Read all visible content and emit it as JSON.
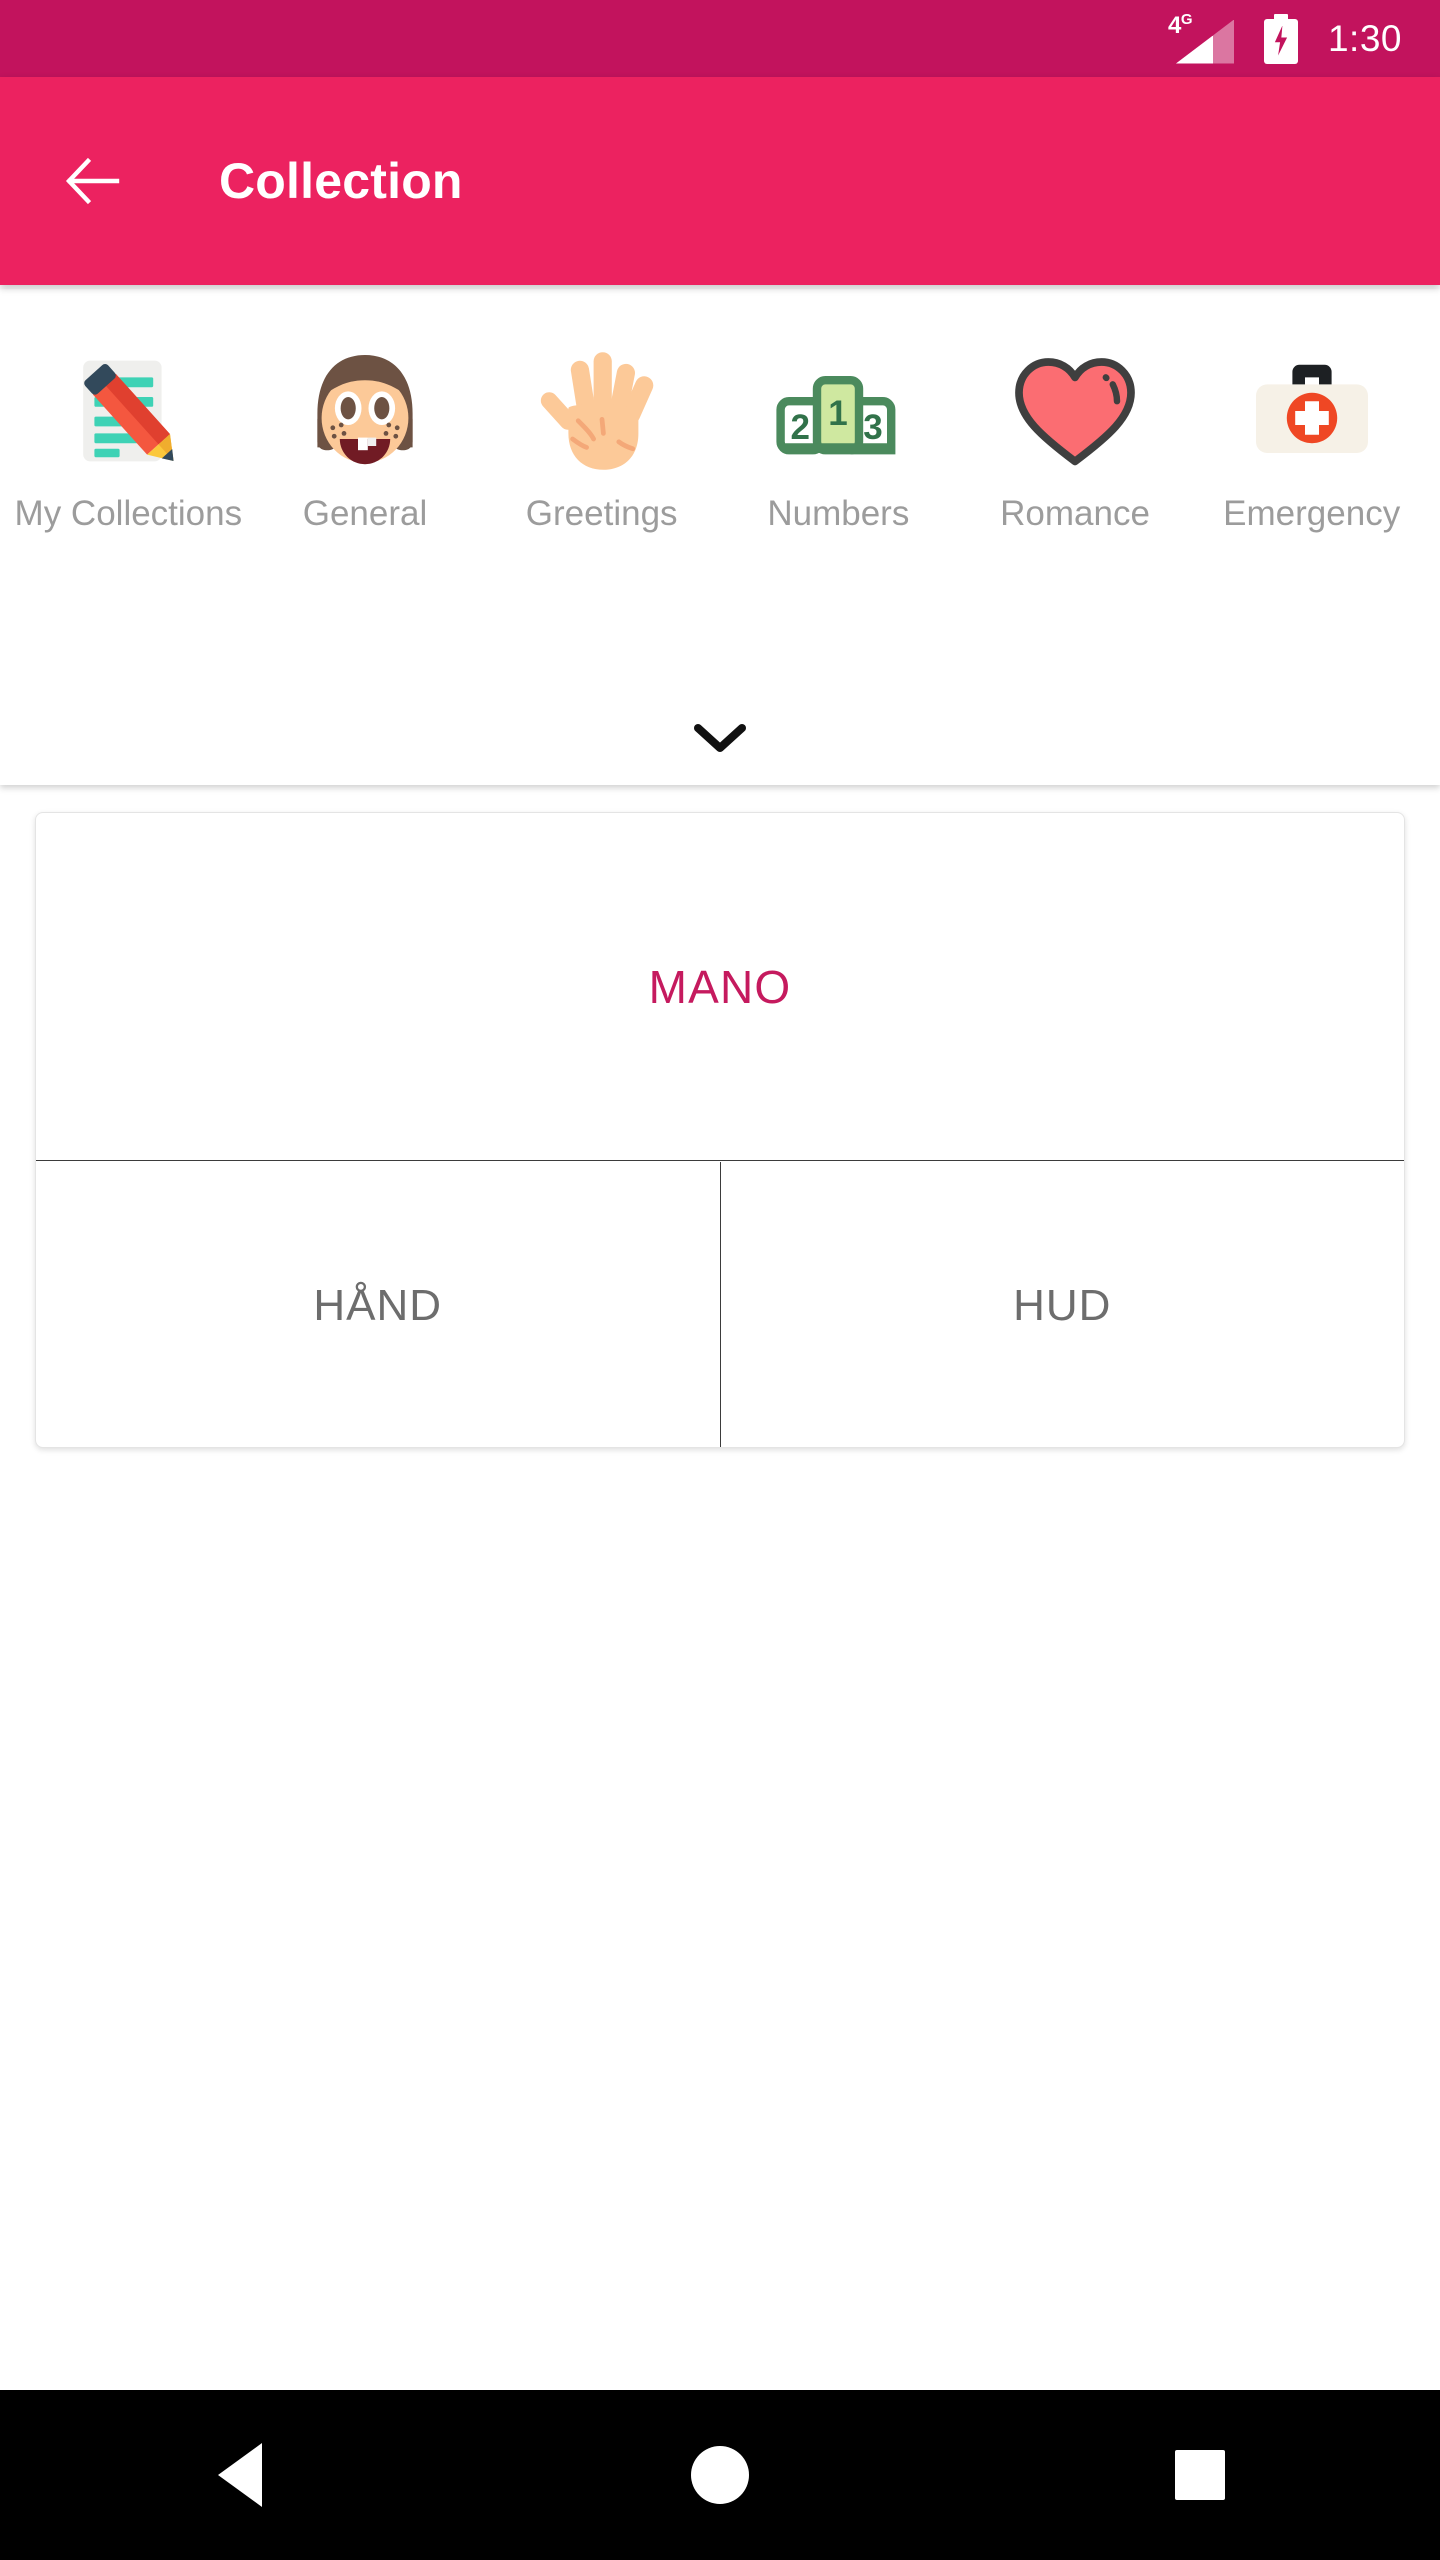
{
  "status_bar": {
    "network_label": "4G",
    "network_sup": "G",
    "network_main": "4",
    "time": "1:30",
    "signal_icon": "signal-bars-icon",
    "battery_icon": "battery-charging-icon",
    "background_color": "#c2135d"
  },
  "app_bar": {
    "back_icon": "arrow-left-icon",
    "title": "Collection",
    "background_color": "#ec2260",
    "text_color": "#ffffff"
  },
  "categories": {
    "expand_icon": "chevron-down-icon",
    "label_color": "#9c9c9c",
    "items": [
      {
        "label": "My Collections",
        "icon": "memo-note-pencil-icon"
      },
      {
        "label": "General",
        "icon": "girl-face-icon"
      },
      {
        "label": "Greetings",
        "icon": "raised-hand-icon"
      },
      {
        "label": "Numbers",
        "icon": "podium-123-icon"
      },
      {
        "label": "Romance",
        "icon": "heart-icon"
      },
      {
        "label": "Emergency",
        "icon": "first-aid-kit-icon"
      }
    ]
  },
  "card": {
    "headword": "MANO",
    "headword_color": "#c51a5e",
    "translations": [
      {
        "text": "HÅND"
      },
      {
        "text": "HUD"
      }
    ],
    "translation_color": "#6d6d6d"
  },
  "nav_bar": {
    "back_icon": "nav-back-triangle-icon",
    "home_icon": "nav-home-circle-icon",
    "recents_icon": "nav-recents-square-icon",
    "background_color": "#000000"
  }
}
